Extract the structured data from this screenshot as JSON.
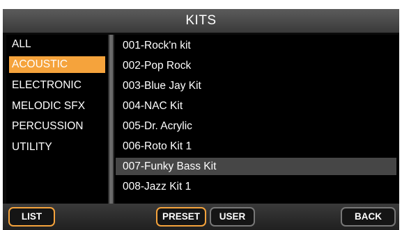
{
  "title": "KITS",
  "categories": [
    {
      "label": "ALL",
      "selected": false
    },
    {
      "label": "ACOUSTIC",
      "selected": true
    },
    {
      "label": "ELECTRONIC",
      "selected": false
    },
    {
      "label": "MELODIC SFX",
      "selected": false
    },
    {
      "label": "PERCUSSION",
      "selected": false
    },
    {
      "label": "UTILITY",
      "selected": false
    }
  ],
  "kits": [
    {
      "label": "001-Rock'n kit",
      "selected": false
    },
    {
      "label": "002-Pop Rock",
      "selected": false
    },
    {
      "label": "003-Blue Jay Kit",
      "selected": false
    },
    {
      "label": "004-NAC Kit",
      "selected": false
    },
    {
      "label": "005-Dr. Acrylic",
      "selected": false
    },
    {
      "label": "006-Roto Kit 1",
      "selected": false
    },
    {
      "label": "007-Funky Bass Kit",
      "selected": true
    },
    {
      "label": "008-Jazz Kit 1",
      "selected": false
    }
  ],
  "buttons": {
    "list": "LIST",
    "preset": "PRESET",
    "user": "USER",
    "back": "BACK"
  },
  "colors": {
    "accent": "#f5a33c",
    "selected_row": "#464646"
  }
}
